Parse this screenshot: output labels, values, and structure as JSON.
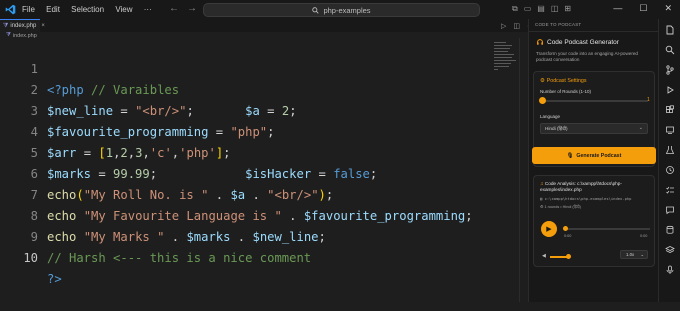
{
  "menu": [
    "File",
    "Edit",
    "Selection",
    "View"
  ],
  "search": {
    "text": "php-examples"
  },
  "tabs": [
    {
      "label": "index.php"
    }
  ],
  "breadcrumb": {
    "file": "index.php"
  },
  "code_lines": [
    {
      "num": "1"
    },
    {
      "num": "2"
    },
    {
      "num": "3"
    },
    {
      "num": "4"
    },
    {
      "num": "5"
    },
    {
      "num": "6"
    },
    {
      "num": "7"
    },
    {
      "num": "8"
    },
    {
      "num": "9"
    },
    {
      "num": "10"
    }
  ],
  "panel": {
    "header": "CODE TO PODCAST",
    "title": "Code Podcast Generator",
    "description": "Transform your code into an engaging AI-powered podcast conversation",
    "settings_title": "Podcast Settings",
    "rounds_label": "Number of Rounds (1-10)",
    "rounds_value": "1",
    "language_label": "Language",
    "language_value": "Hindi (हिंदी)",
    "generate_label": "Generate Podcast",
    "analysis_title": "Code Analysis: c:\\xampp\\htdocs\\php-examples\\index.php",
    "analysis_path": "c:\\xampp\\htdocs\\php-examples\\index.php",
    "analysis_meta": "1 rounds • Hindi (हिंदी)",
    "time_start": "0:00",
    "time_end": "0:00",
    "speed": "1.0x",
    "progress": 0,
    "volume": 0.6
  },
  "colors": {
    "accent": "#f59e0b",
    "editor_bg": "#1e1e1e",
    "php_tag": "#569cd6",
    "comment": "#6a9955",
    "variable": "#9cdcfe",
    "string": "#ce9178",
    "number": "#b5cea8",
    "function": "#dcdcaa"
  }
}
